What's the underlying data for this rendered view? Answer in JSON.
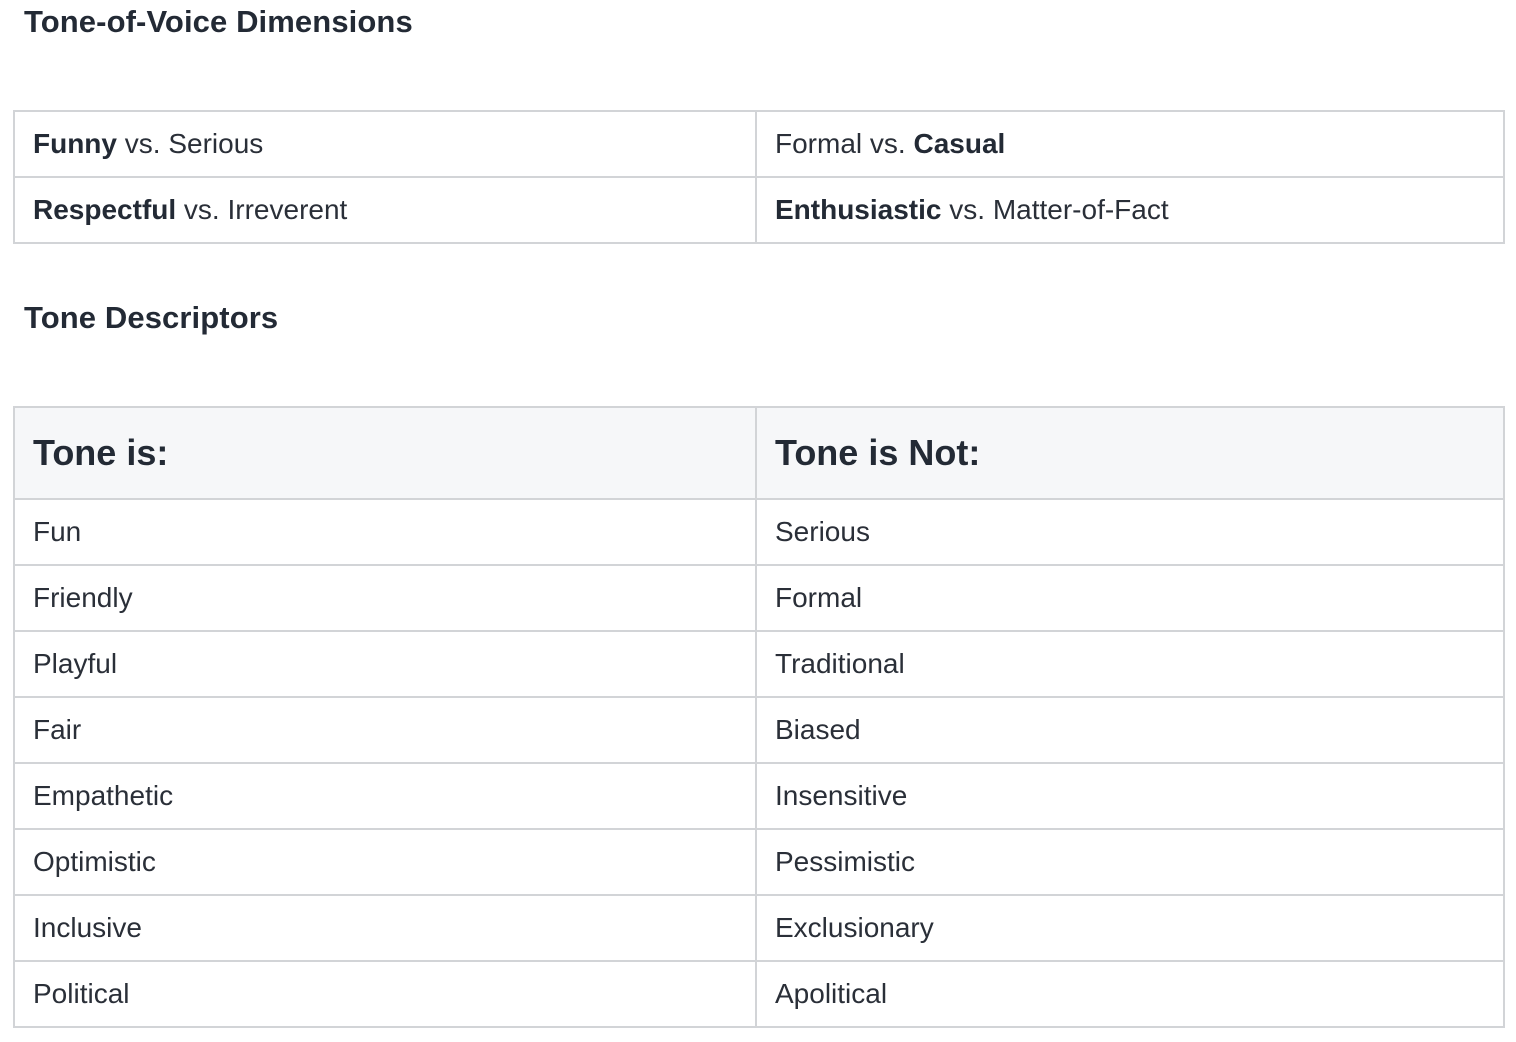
{
  "dimensions": {
    "title": "Tone-of-Voice Dimensions",
    "rows": [
      [
        {
          "bold": "Funny",
          "rest": " vs. Serious"
        },
        {
          "pre": "Formal vs. ",
          "bold": "Casual"
        }
      ],
      [
        {
          "bold": "Respectful",
          "rest": " vs. Irreverent"
        },
        {
          "bold": "Enthusiastic",
          "rest": " vs. Matter-of-Fact"
        }
      ]
    ]
  },
  "descriptors": {
    "title": "Tone Descriptors",
    "headers": [
      "Tone is:",
      "Tone is Not:"
    ],
    "rows": [
      [
        "Fun",
        "Serious"
      ],
      [
        "Friendly",
        "Formal"
      ],
      [
        "Playful",
        "Traditional"
      ],
      [
        "Fair",
        "Biased"
      ],
      [
        "Empathetic",
        "Insensitive"
      ],
      [
        "Optimistic",
        "Pessimistic"
      ],
      [
        "Inclusive",
        "Exclusionary"
      ],
      [
        "Political",
        "Apolitical"
      ]
    ]
  }
}
